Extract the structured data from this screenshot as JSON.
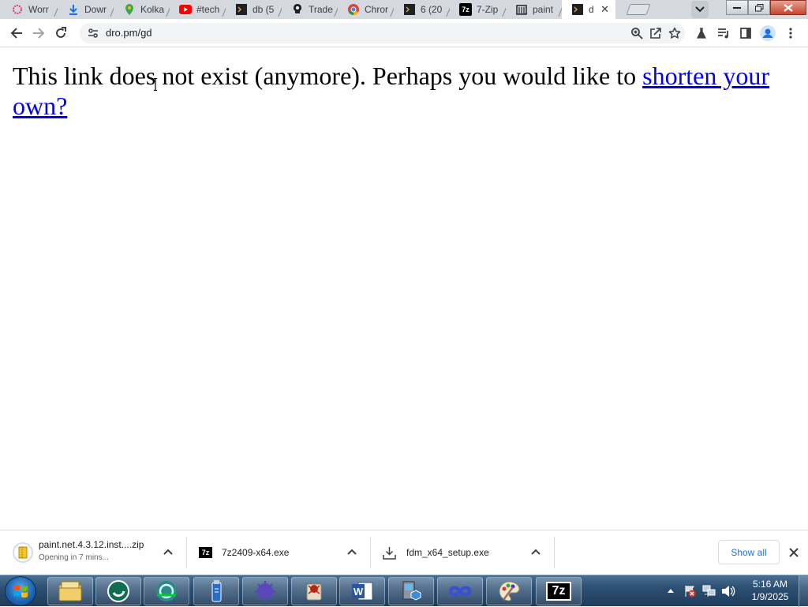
{
  "tabs": [
    {
      "label": "Worr",
      "icon": "ring-logo-icon",
      "color": "#e0397a"
    },
    {
      "label": "Dowr",
      "icon": "download-icon",
      "color": "#1a73e8"
    },
    {
      "label": "Kolka",
      "icon": "maps-pin-icon",
      "color": "#34a853"
    },
    {
      "label": "#tech",
      "icon": "youtube-icon",
      "color": "#ff0000"
    },
    {
      "label": "db (5",
      "icon": "terminal-icon",
      "color": "#202124"
    },
    {
      "label": "Trade",
      "icon": "bulb-icon",
      "color": "#202124"
    },
    {
      "label": "Chror",
      "icon": "chrome-icon",
      "color": "#4285f4"
    },
    {
      "label": "6 (20",
      "icon": "terminal-icon",
      "color": "#202124"
    },
    {
      "label": "7-Zip",
      "icon": "7zip-icon",
      "color": "#000000"
    },
    {
      "label": "paint",
      "icon": "paint-net-icon",
      "color": "#202124"
    },
    {
      "label": "d",
      "icon": "terminal-icon",
      "color": "#202124",
      "active": true
    }
  ],
  "toolbar": {
    "url": "dro.pm/gd"
  },
  "page": {
    "message": "This link does not exist (anymore). Perhaps you would like to ",
    "link_text": "shorten your own?"
  },
  "downloads": [
    {
      "name": "paint.net.4.3.12.inst....zip",
      "status": "Opening in 7 mins...",
      "icon": "zip-file-icon"
    },
    {
      "name": "7z2409-x64.exe",
      "status": "",
      "icon": "7zip-icon"
    },
    {
      "name": "fdm_x64_setup.exe",
      "status": "",
      "icon": "installer-icon"
    }
  ],
  "shelf": {
    "show_all_label": "Show all"
  },
  "taskbar": {
    "apps": [
      {
        "name": "explorer-icon"
      },
      {
        "name": "app-swirl-icon"
      },
      {
        "name": "globe-app-icon"
      },
      {
        "name": "usb-drive-icon"
      },
      {
        "name": "virus-app-icon"
      },
      {
        "name": "spider-app-icon"
      },
      {
        "name": "word-icon"
      },
      {
        "name": "computer-app-icon"
      },
      {
        "name": "infinity-app-icon"
      },
      {
        "name": "paint-palette-icon"
      },
      {
        "name": "7zip-icon"
      }
    ],
    "time": "5:16 AM",
    "date": "1/9/2025"
  }
}
